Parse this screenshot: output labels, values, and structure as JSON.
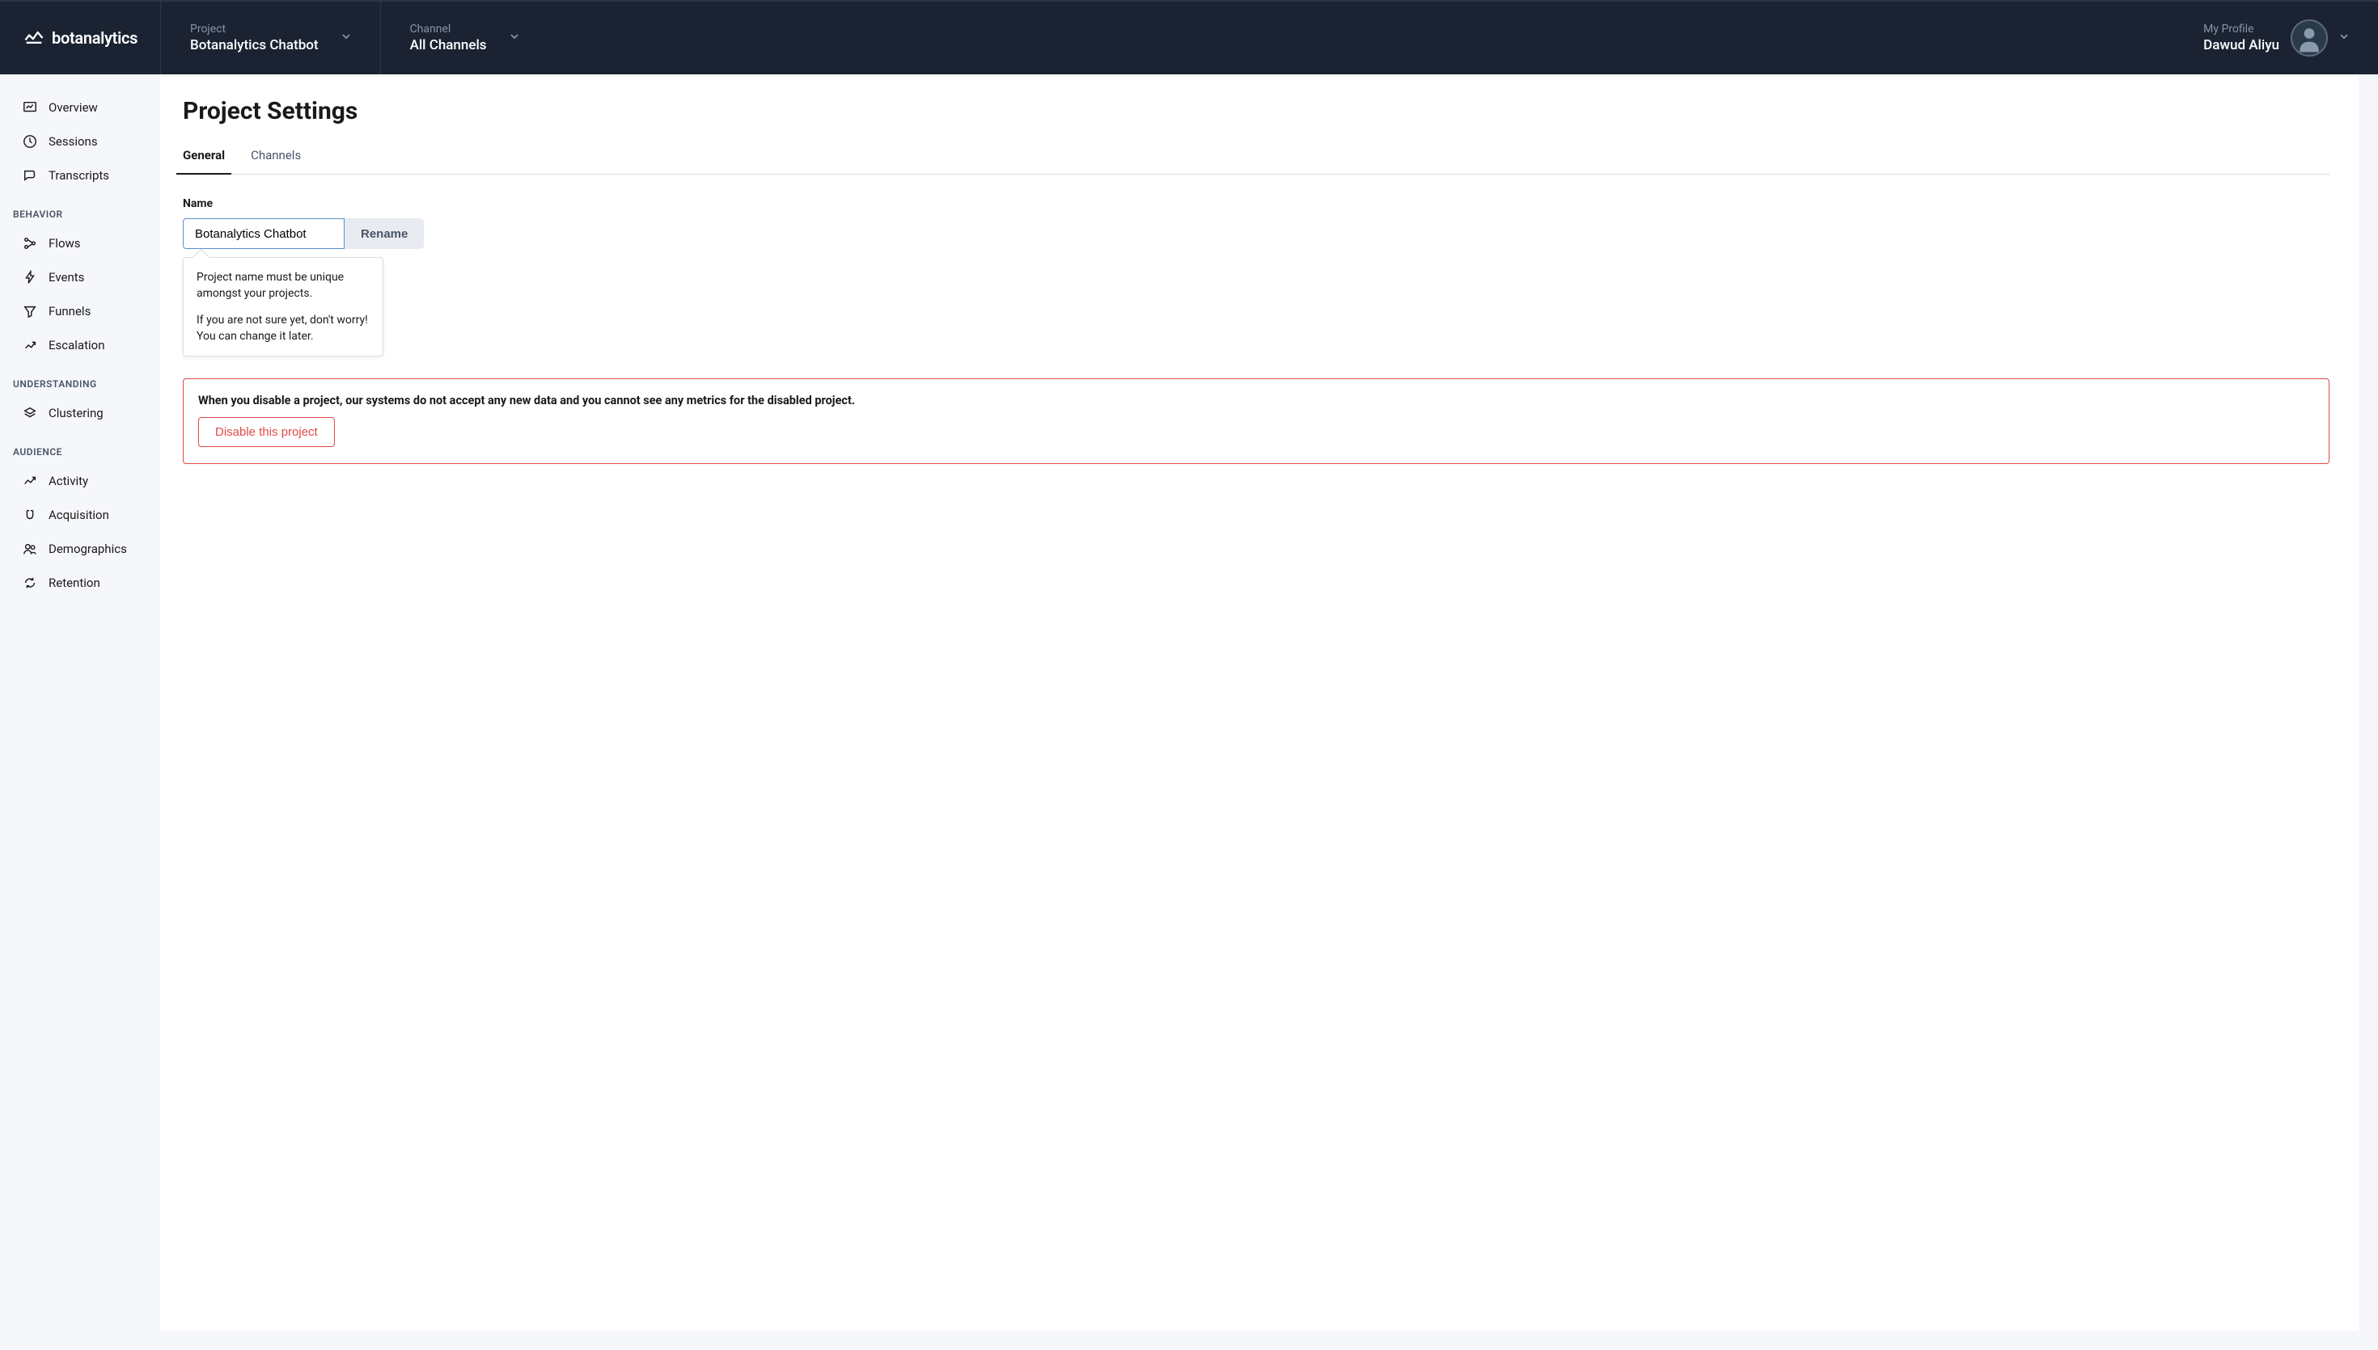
{
  "brand": "botanalytics",
  "header": {
    "project_label": "Project",
    "project_value": "Botanalytics Chatbot",
    "channel_label": "Channel",
    "channel_value": "All Channels",
    "profile_label": "My Profile",
    "profile_value": "Dawud Aliyu"
  },
  "sidebar": {
    "primary": [
      {
        "label": "Overview"
      },
      {
        "label": "Sessions"
      },
      {
        "label": "Transcripts"
      }
    ],
    "behavior_header": "BEHAVIOR",
    "behavior": [
      {
        "label": "Flows"
      },
      {
        "label": "Events"
      },
      {
        "label": "Funnels"
      },
      {
        "label": "Escalation"
      }
    ],
    "understanding_header": "UNDERSTANDING",
    "understanding": [
      {
        "label": "Clustering"
      }
    ],
    "audience_header": "AUDIENCE",
    "audience": [
      {
        "label": "Activity"
      },
      {
        "label": "Acquisition"
      },
      {
        "label": "Demographics"
      },
      {
        "label": "Retention"
      }
    ]
  },
  "page": {
    "title": "Project Settings",
    "tabs": {
      "general": "General",
      "channels": "Channels"
    },
    "name_label": "Name",
    "name_value": "Botanalytics Chatbot",
    "rename_label": "Rename",
    "tooltip_p1": "Project name must be unique amongst your projects.",
    "tooltip_p2": "If you are not sure yet, don't worry! You can change it later.",
    "danger_text": "When you disable a project, our systems do not accept any new data and you cannot see any metrics for the disabled project.",
    "disable_label": "Disable this project"
  }
}
